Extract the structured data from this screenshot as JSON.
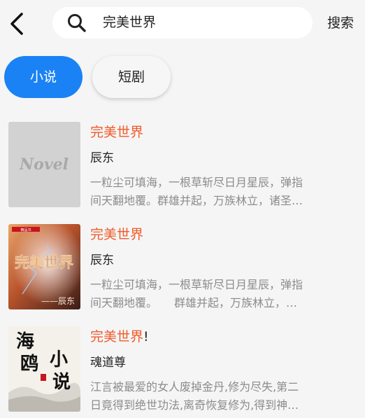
{
  "header": {
    "back_icon": "back-arrow-icon",
    "search_icon": "search-icon",
    "search_value": "完美世界",
    "search_button": "搜索"
  },
  "tabs": [
    {
      "label": "小说",
      "active": true
    },
    {
      "label": "短剧",
      "active": false
    }
  ],
  "results": [
    {
      "title_highlight": "完美世界",
      "title_suffix": "",
      "author": "辰东",
      "desc_line1": "一粒尘可填海，一根草斩尽日月星辰，弹指",
      "desc_line2": "间天翻地覆。群雄并起，万族林立，诸圣…",
      "cover_text": "Novel"
    },
    {
      "title_highlight": "完美世界",
      "title_suffix": "",
      "author": "辰东",
      "desc_line1": "一粒尘可填海，一根草斩尽日月星辰，弹指",
      "desc_line2": "间天翻地覆。　　群雄并起，万族林立，…",
      "cover_text": "完美世界",
      "cover_sub": "——辰东",
      "cover_badge": "精品书"
    },
    {
      "title_highlight": "完美世界",
      "title_suffix": "!",
      "author": "魂道尊",
      "desc_line1": "江言被最爱的女人废掉金丹,修为尽失,第二",
      "desc_line2": "日竟得到绝世功法,离奇恢复修为,得到神…",
      "cover_text1": "海",
      "cover_text2": "鸥",
      "cover_text3": "小",
      "cover_text4": "说"
    }
  ],
  "colors": {
    "accent": "#1a82f5",
    "highlight": "#f05a2a",
    "background": "#f5f5f5"
  }
}
